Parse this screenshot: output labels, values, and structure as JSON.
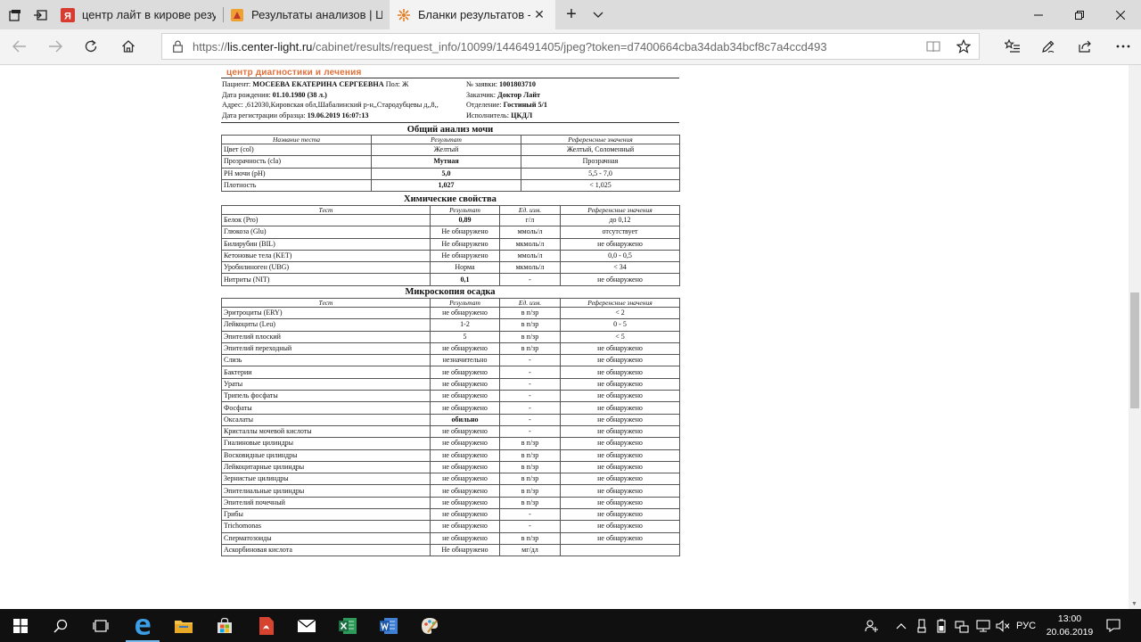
{
  "browser": {
    "tabs": [
      {
        "title": "центр лайт в кирове резул"
      },
      {
        "title": "Результаты анализов | Цен"
      },
      {
        "title": "Бланки результатов - М"
      }
    ],
    "url": {
      "scheme": "https://",
      "host": "lis.center-light.ru",
      "path": "/cabinet/results/request_info/10099/1446491405/jpeg?token=d7400664cba34dab34bcf8c7a4ccd493"
    },
    "accent": "#1e73c8"
  },
  "report": {
    "lab_name": "центр диагностики и лечения",
    "patient": {
      "patient_label": "Пациент:",
      "patient_name": "МОСЕЕВА ЕКАТЕРИНА СЕРГЕЕВНА",
      "sex_label": "Пол:",
      "sex": "Ж",
      "dob_label": "Дата рождения:",
      "dob": "01.10.1980 (38 л.)",
      "address_label": "Адрес:",
      "address": ",612030,Кировская обл,Шабалинский р-н,,Стародубцевы д,,8,,",
      "reg_label": "Дата регистрации образца:",
      "reg_date": "19.06.2019 16:07:13",
      "order_label": "№ заявки:",
      "order_no": "1001803710",
      "customer_label": "Заказчик:",
      "customer": "Доктор Лайт",
      "dept_label": "Отделение:",
      "dept": "Гостиный 5/1",
      "exec_label": "Исполнитель:",
      "executor": "ЦКДЛ"
    },
    "sections": [
      {
        "title": "Общий анализ мочи",
        "headers": [
          "Название теста",
          "Результат",
          "Референсные значения"
        ],
        "rows": [
          [
            "Цвет (col)",
            "Желтый",
            "Желтый, Соломенный"
          ],
          [
            "Прозрачность (cla)",
            "Мутная",
            "Прозрачная"
          ],
          [
            "PH мочи (pH)",
            "5,0",
            "5,5 - 7,0"
          ],
          [
            "Плотность",
            "1,027",
            "< 1,025"
          ]
        ]
      },
      {
        "title": "Химические свойства",
        "headers": [
          "Тест",
          "Результат",
          "Ед. изм.",
          "Референсные значения"
        ],
        "rows": [
          [
            "Белок (Pro)",
            "0,89",
            "г/л",
            "до 0,12"
          ],
          [
            "Глюкоза (Glu)",
            "Не обнаружено",
            "ммоль/л",
            "отсутствует"
          ],
          [
            "Билирубин (BIL)",
            "Не обнаружено",
            "мкмоль/л",
            "не обнаружено"
          ],
          [
            "Кетоновые тела (KET)",
            "Не обнаружено",
            "ммоль/л",
            "0,0 - 0,5"
          ],
          [
            "Уробилиноген (UBG)",
            "Норма",
            "мкмоль/л",
            "< 34"
          ],
          [
            "Нитриты (NIT)",
            "0,1",
            "-",
            "не обнаружено"
          ]
        ]
      },
      {
        "title": "Микроскопия осадка",
        "headers": [
          "Тест",
          "Результат",
          "Ед. изм.",
          "Референсные значения"
        ],
        "rows": [
          [
            "Эритроциты (ERY)",
            "не обнаружено",
            "в п/зр",
            "< 2"
          ],
          [
            "Лейкоциты (Leu)",
            "1-2",
            "в п/зр",
            "0 - 5"
          ],
          [
            "Эпителий плоский",
            "5",
            "в п/зр",
            "< 5"
          ],
          [
            "Эпителий переходный",
            "не обнаружено",
            "в п/зр",
            "не обнаружено"
          ],
          [
            "Слизь",
            "незначительно",
            "-",
            "не обнаружено"
          ],
          [
            "Бактерии",
            "не обнаружено",
            "-",
            "не обнаружено"
          ],
          [
            "Ураты",
            "не обнаружено",
            "-",
            "не обнаружено"
          ],
          [
            "Трипель фосфаты",
            "не обнаружено",
            "-",
            "не обнаружено"
          ],
          [
            "Фосфаты",
            "не обнаружено",
            "-",
            "не обнаружено"
          ],
          [
            "Оксалаты",
            "обильно",
            "-",
            "не обнаружено"
          ],
          [
            "Кристаллы мочевой кислоты",
            "не обнаружено",
            "-",
            "не обнаружено"
          ],
          [
            "Гиалиновые цилиндры",
            "не обнаружено",
            "в п/зр",
            "не обнаружено"
          ],
          [
            "Восковидные цилиндры",
            "не обнаружено",
            "в п/зр",
            "не обнаружено"
          ],
          [
            "Лейкоцитарные цилиндры",
            "не обнаружено",
            "в п/зр",
            "не обнаружено"
          ],
          [
            "Зернистые цилиндры",
            "не обнаружено",
            "в п/зр",
            "не обнаружено"
          ],
          [
            "Эпителиальные цилиндры",
            "не обнаружено",
            "в п/зр",
            "не обнаружено"
          ],
          [
            "Эпителий почечный",
            "не обнаружено",
            "в п/зр",
            "не обнаружено"
          ],
          [
            "Грибы",
            "не обнаружено",
            "-",
            "не обнаружено"
          ],
          [
            "Trichomonas",
            "не обнаружено",
            "-",
            "не обнаружено"
          ],
          [
            "Сперматозоиды",
            "не обнаружено",
            "в п/зр",
            "не обнаружено"
          ],
          [
            "Аскорбиновая кислота",
            "Не обнаружено",
            "мг/дл",
            ""
          ]
        ]
      }
    ],
    "bold_results": [
      "Мутная",
      "5,0",
      "1,027",
      "0,89",
      "0,1",
      "обильно"
    ]
  },
  "taskbar": {
    "lang": "РУС",
    "time": "13:00",
    "date": "20.06.2019"
  }
}
